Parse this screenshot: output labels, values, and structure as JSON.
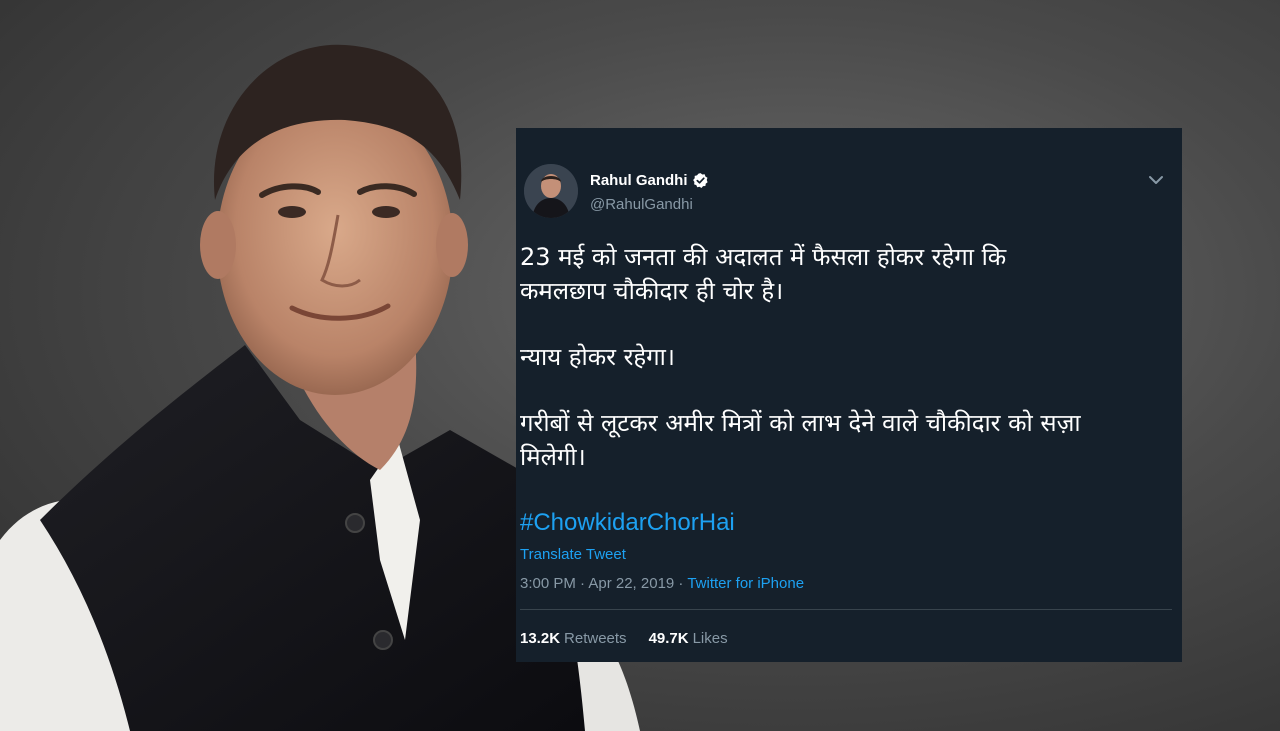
{
  "tweet": {
    "author_name": "Rahul Gandhi",
    "author_handle": "@RahulGandhi",
    "paragraphs": [
      "23 मई को जनता की अदालत में फैसला होकर रहेगा कि\nकमलछाप चौकीदार ही चोर है।",
      "न्याय होकर रहेगा।",
      "गरीबों से लूटकर अमीर मित्रों को लाभ देने वाले चौकीदार को सज़ा\nमिलेगी।"
    ],
    "hashtag": "#ChowkidarChorHai",
    "translate_label": "Translate Tweet",
    "timestamp": "3:00 PM · Apr 22, 2019 · ",
    "source": "Twitter for iPhone",
    "retweets_count": "13.2K",
    "retweets_label": "Retweets",
    "likes_count": "49.7K",
    "likes_label": "Likes"
  },
  "colors": {
    "card_background": "#15202b",
    "link_blue": "#1da1f2",
    "secondary_text": "#8899a6"
  },
  "icons": [
    "verified-badge-icon",
    "chevron-down-icon"
  ]
}
